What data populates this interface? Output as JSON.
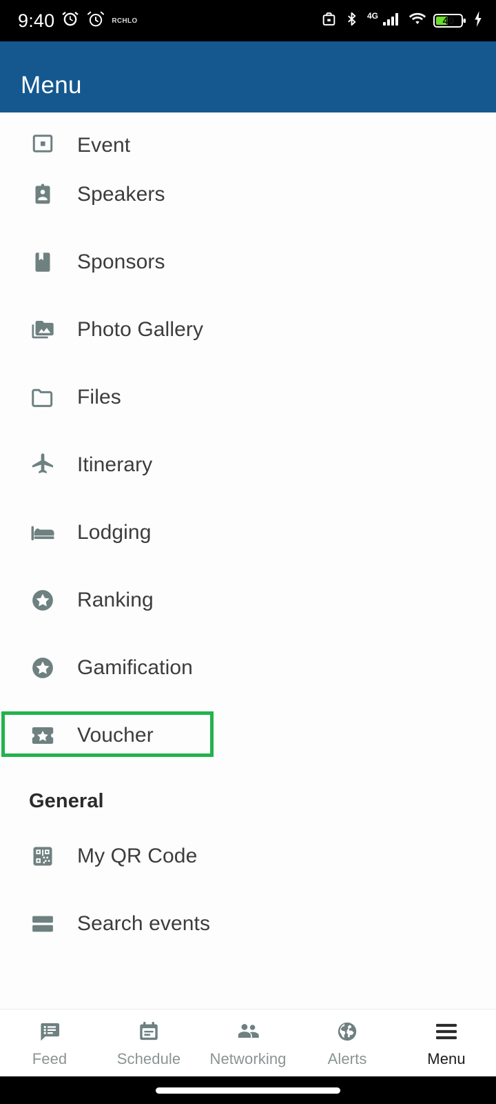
{
  "statusbar": {
    "time": "9:40",
    "carrier_label": "RCHLO",
    "network_type": "4G",
    "battery_percent": "40",
    "icons": [
      "alarm-clock-icon",
      "clock-icon",
      "work-profile-briefcase-icon",
      "bluetooth-icon",
      "cellular-signal-icon",
      "wifi-icon",
      "battery-icon",
      "charging-bolt-icon"
    ]
  },
  "appbar": {
    "title": "Menu"
  },
  "menu": {
    "items": [
      {
        "label": "Event",
        "icon": "event-square-icon",
        "clipped": true,
        "highlighted": false
      },
      {
        "label": "Speakers",
        "icon": "id-badge-icon",
        "clipped": false,
        "highlighted": false
      },
      {
        "label": "Sponsors",
        "icon": "bookmark-icon",
        "clipped": false,
        "highlighted": false
      },
      {
        "label": "Photo Gallery",
        "icon": "photo-folder-icon",
        "clipped": false,
        "highlighted": false
      },
      {
        "label": "Files",
        "icon": "folder-icon",
        "clipped": false,
        "highlighted": false
      },
      {
        "label": "Itinerary",
        "icon": "airplane-icon",
        "clipped": false,
        "highlighted": false
      },
      {
        "label": "Lodging",
        "icon": "hotel-bed-icon",
        "clipped": false,
        "highlighted": false
      },
      {
        "label": "Ranking",
        "icon": "star-circle-icon",
        "clipped": false,
        "highlighted": false
      },
      {
        "label": "Gamification",
        "icon": "star-circle-icon",
        "clipped": false,
        "highlighted": false
      },
      {
        "label": "Voucher",
        "icon": "ticket-star-icon",
        "clipped": false,
        "highlighted": true
      }
    ],
    "section_general": {
      "title": "General",
      "items": [
        {
          "label": "My QR Code",
          "icon": "qr-code-icon"
        },
        {
          "label": "Search events",
          "icon": "view-agenda-icon"
        }
      ]
    }
  },
  "bottomnav": {
    "items": [
      {
        "label": "Feed",
        "icon": "feed-bubble-icon",
        "active": false
      },
      {
        "label": "Schedule",
        "icon": "calendar-icon",
        "active": false
      },
      {
        "label": "Networking",
        "icon": "people-icon",
        "active": false
      },
      {
        "label": "Alerts",
        "icon": "globe-icon",
        "active": false
      },
      {
        "label": "Menu",
        "icon": "hamburger-menu-icon",
        "active": true
      }
    ]
  },
  "colors": {
    "appbar_blue": "#14588f",
    "highlight_green": "#22b24c",
    "icon_gray": "#6e8080",
    "label_dark": "#3c3c3c"
  }
}
